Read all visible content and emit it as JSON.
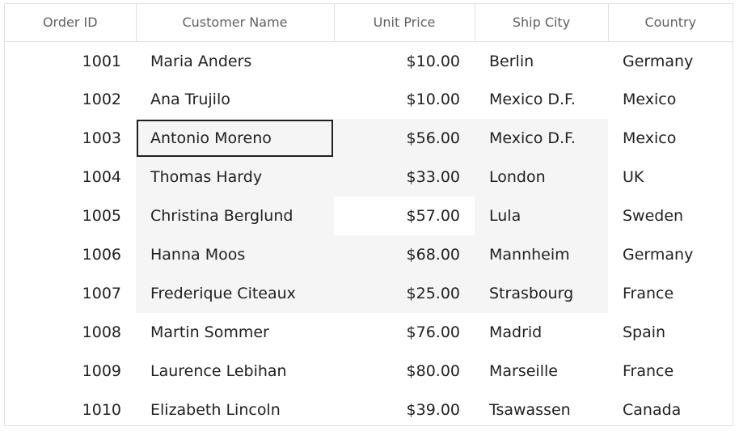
{
  "columns": [
    "Order ID",
    "Customer Name",
    "Unit Price",
    "Ship City",
    "Country"
  ],
  "rows": [
    [
      "1001",
      "Maria Anders",
      "$10.00",
      "Berlin",
      "Germany"
    ],
    [
      "1002",
      "Ana Trujilo",
      "$10.00",
      "Mexico D.F.",
      "Mexico"
    ],
    [
      "1003",
      "Antonio Moreno",
      "$56.00",
      "Mexico D.F.",
      "Mexico"
    ],
    [
      "1004",
      "Thomas Hardy",
      "$33.00",
      "London",
      "UK"
    ],
    [
      "1005",
      "Christina Berglund",
      "$57.00",
      "Lula",
      "Sweden"
    ],
    [
      "1006",
      "Hanna Moos",
      "$68.00",
      "Mannheim",
      "Germany"
    ],
    [
      "1007",
      "Frederique Citeaux",
      "$25.00",
      "Strasbourg",
      "France"
    ],
    [
      "1008",
      "Martin Sommer",
      "$76.00",
      "Madrid",
      "Spain"
    ],
    [
      "1009",
      "Laurence Lebihan",
      "$80.00",
      "Marseille",
      "France"
    ],
    [
      "1010",
      "Elizabeth Lincoln",
      "$39.00",
      "Tsawassen",
      "Canada"
    ]
  ],
  "colors": {
    "header_text": "#616161",
    "cell_text": "#212121",
    "selection_fill": "#f5f5f5",
    "border": "#e0e0e0"
  }
}
